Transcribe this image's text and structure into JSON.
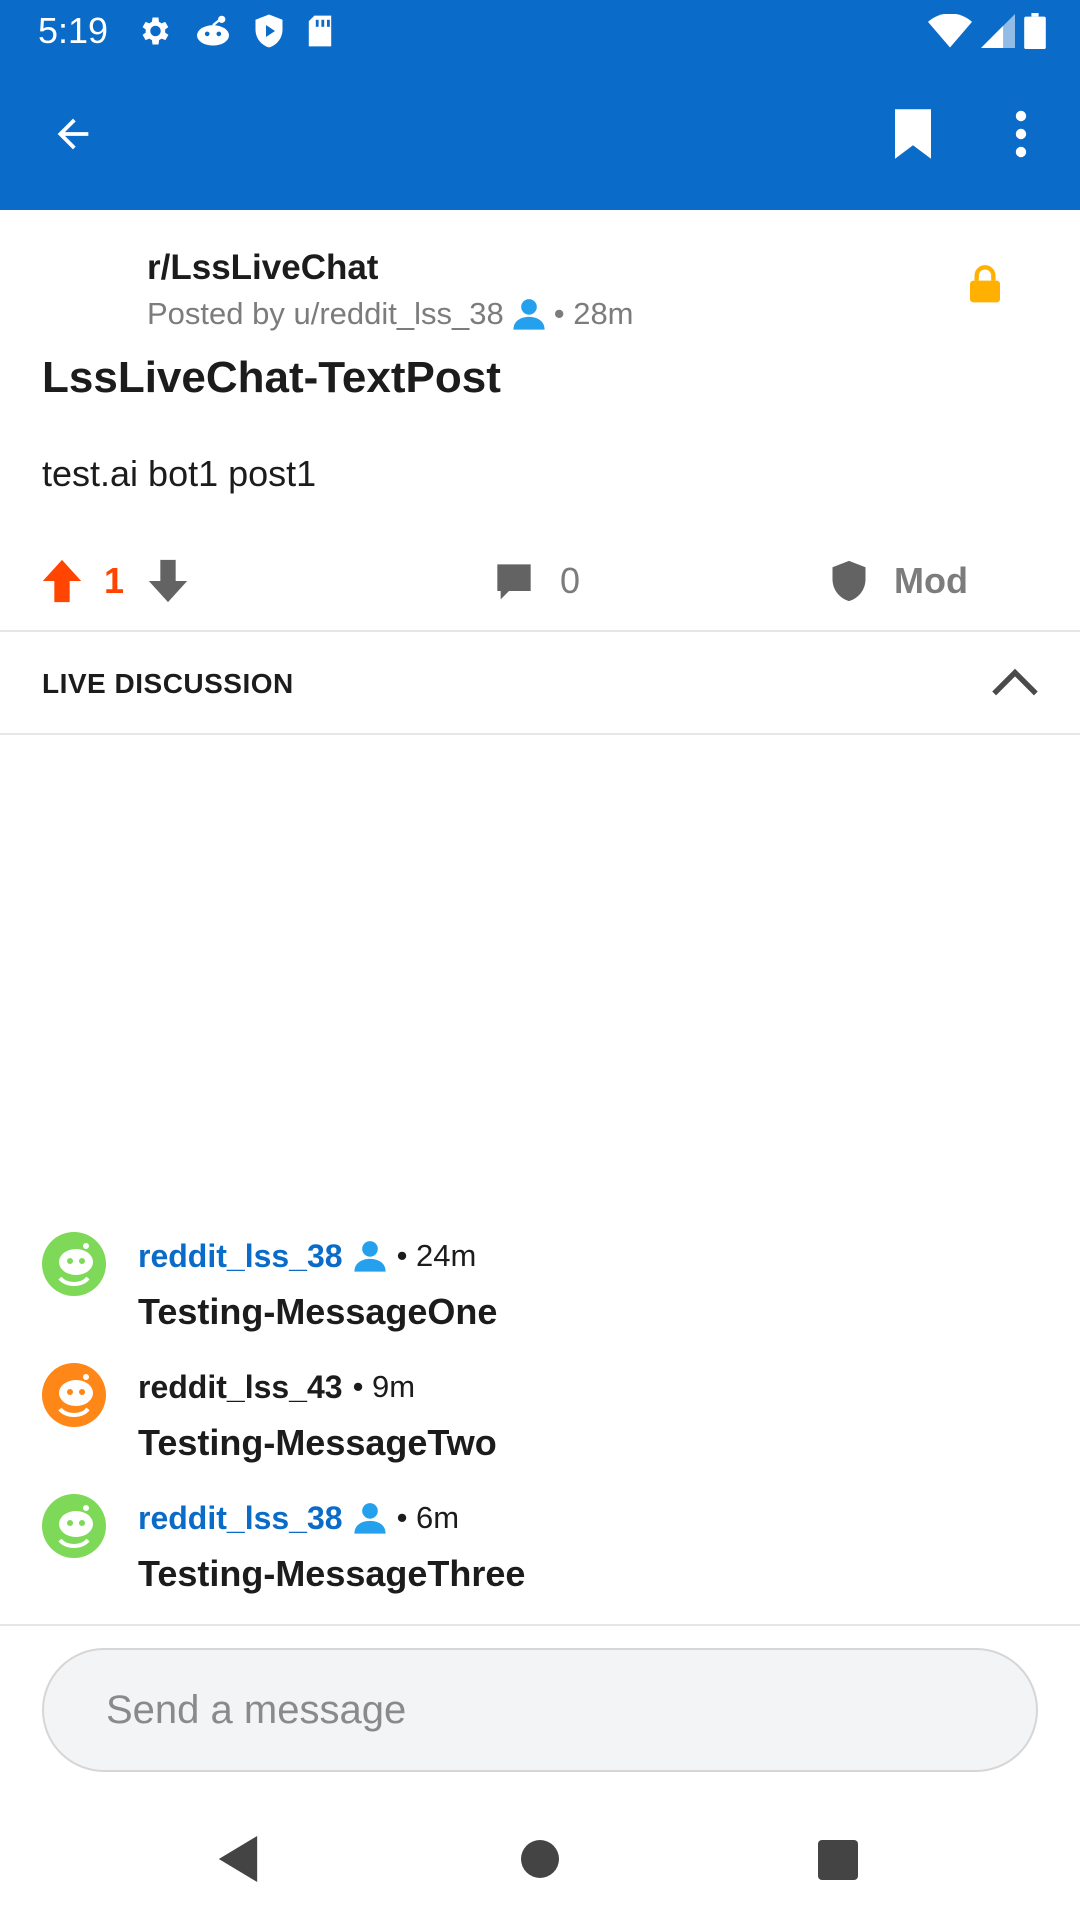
{
  "status_bar": {
    "time": "5:19",
    "icons_left": [
      "gear-icon",
      "reddit-icon",
      "shield-icon",
      "sd-card-icon"
    ],
    "icons_right": [
      "wifi-icon",
      "signal-icon",
      "battery-icon"
    ]
  },
  "app_bar": {
    "icons": [
      "back-arrow-icon",
      "bookmark-icon",
      "more-vertical-icon"
    ]
  },
  "post": {
    "subreddit": "r/LssLiveChat",
    "posted_by": "Posted by u/reddit_lss_38",
    "age": "• 28m",
    "title": "LssLiveChat-TextPost",
    "body": "test.ai bot1 post1",
    "score": "1",
    "comments": "0",
    "mod_label": "Mod",
    "lock_color": "#ffb000"
  },
  "live": {
    "title": "LIVE DISCUSSION"
  },
  "messages": [
    {
      "user": "reddit_lss_38",
      "time": "• 24m",
      "text": "Testing-MessageOne",
      "avatar_color": "#7dd957",
      "is_op": true
    },
    {
      "user": "reddit_lss_43",
      "time": "• 9m",
      "text": "Testing-MessageTwo",
      "avatar_color": "#ff8717",
      "is_op": false
    },
    {
      "user": "reddit_lss_38",
      "time": "• 6m",
      "text": "Testing-MessageThree",
      "avatar_color": "#7dd957",
      "is_op": true
    }
  ],
  "composer": {
    "placeholder": "Send a message"
  },
  "colors": {
    "app_bar": "#0b6bc8",
    "upvote": "#ff4500",
    "op_user": "#0b6bc8",
    "op_badge": "#24a0ed"
  }
}
